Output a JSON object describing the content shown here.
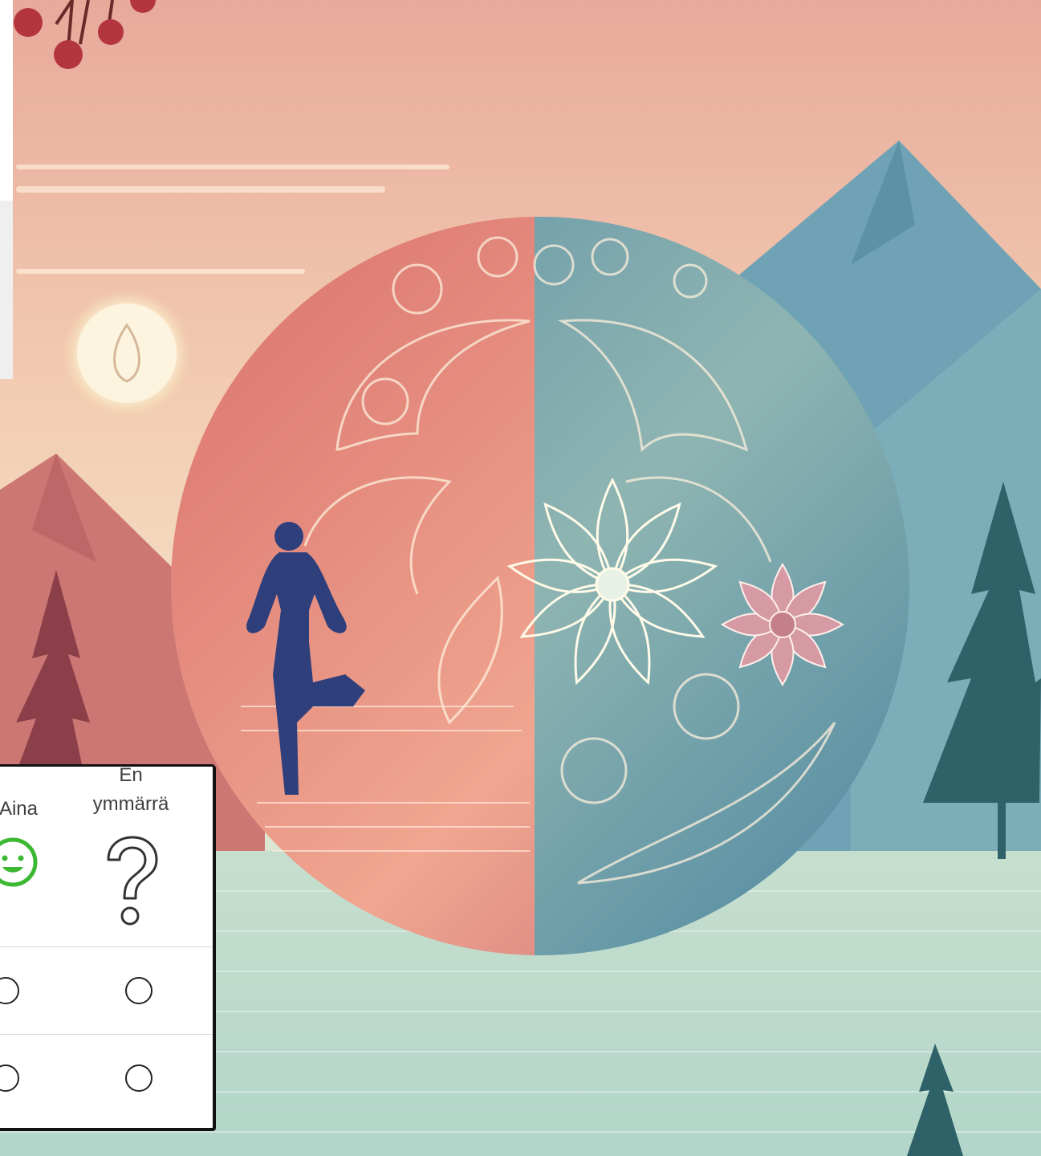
{
  "survey": {
    "columns": [
      {
        "label": "Aina",
        "icon": "smiley-face-icon",
        "color": "#3db832"
      },
      {
        "label_line1": "En",
        "label_line2": "ymmärrä",
        "icon": "question-mark-icon",
        "color": "#333333"
      }
    ],
    "rows": 2
  },
  "colors": {
    "sky_top": "#e8a79a",
    "sky_mid": "#f1d3b9",
    "water": "#b7d8cd",
    "brain_left": "#e07a76",
    "brain_right": "#4c8aa0",
    "figure": "#2e3f7c",
    "mountain_left": "#c96a6a",
    "mountain_right": "#5f98ad",
    "tree": "#2f5f5f",
    "berries": "#b8343e"
  }
}
